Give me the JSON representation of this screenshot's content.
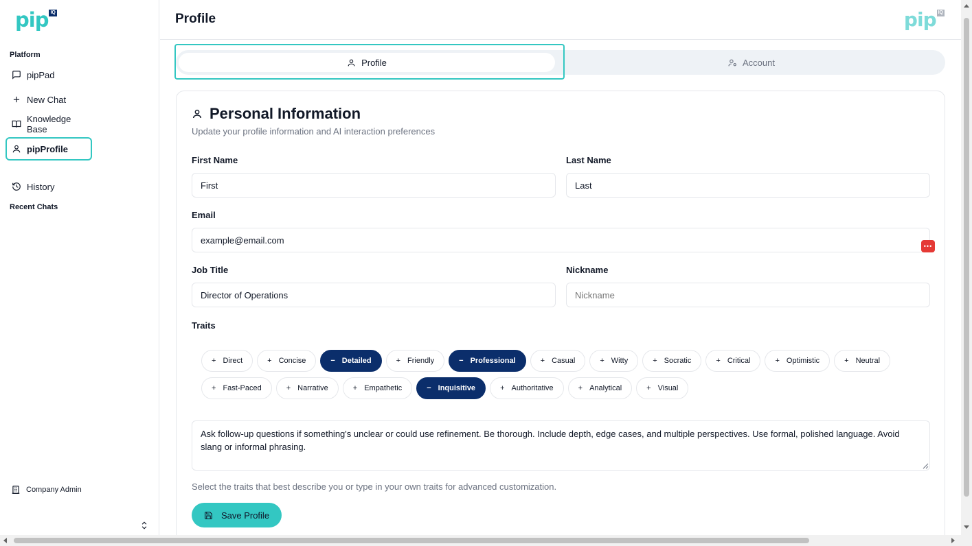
{
  "colors": {
    "brand": "#33c7c2",
    "brand_dark": "#0b2e6b",
    "trait_selected": "#0b2e6b",
    "password_manager": "#e53935"
  },
  "brand": {
    "logo_text": "pip",
    "logo_badge": "IQ"
  },
  "sidebar": {
    "section_platform": "Platform",
    "items": [
      {
        "label": "pipPad",
        "icon": "message-square-icon",
        "active": false
      },
      {
        "label": "New Chat",
        "icon": "plus-icon",
        "active": false
      },
      {
        "label": "Knowledge Base",
        "icon": "book-open-icon",
        "active": false
      },
      {
        "label": "pipProfile",
        "icon": "user-icon",
        "active": true
      },
      {
        "label": "History",
        "icon": "history-icon",
        "active": false
      }
    ],
    "section_recent": "Recent Chats",
    "footer_label": "Company Admin"
  },
  "header": {
    "title": "Profile"
  },
  "tabs": [
    {
      "label": "Profile",
      "icon": "user-icon",
      "active": true
    },
    {
      "label": "Account",
      "icon": "user-cog-icon",
      "active": false
    }
  ],
  "card": {
    "title": "Personal Information",
    "subtitle": "Update your profile information and AI interaction preferences"
  },
  "form": {
    "first_name": {
      "label": "First Name",
      "value": "First"
    },
    "last_name": {
      "label": "Last Name",
      "value": "Last"
    },
    "email": {
      "label": "Email",
      "value": "example@email.com"
    },
    "job_title": {
      "label": "Job Title",
      "value": "Director of Operations"
    },
    "nickname": {
      "label": "Nickname",
      "placeholder": "Nickname"
    },
    "traits_label": "Traits",
    "traits": [
      {
        "label": "Direct",
        "selected": false
      },
      {
        "label": "Concise",
        "selected": false
      },
      {
        "label": "Detailed",
        "selected": true
      },
      {
        "label": "Friendly",
        "selected": false
      },
      {
        "label": "Professional",
        "selected": true
      },
      {
        "label": "Casual",
        "selected": false
      },
      {
        "label": "Witty",
        "selected": false
      },
      {
        "label": "Socratic",
        "selected": false
      },
      {
        "label": "Critical",
        "selected": false
      },
      {
        "label": "Optimistic",
        "selected": false
      },
      {
        "label": "Neutral",
        "selected": false
      },
      {
        "label": "Fast-Paced",
        "selected": false
      },
      {
        "label": "Narrative",
        "selected": false
      },
      {
        "label": "Empathetic",
        "selected": false
      },
      {
        "label": "Inquisitive",
        "selected": true
      },
      {
        "label": "Authoritative",
        "selected": false
      },
      {
        "label": "Analytical",
        "selected": false
      },
      {
        "label": "Visual",
        "selected": false
      }
    ],
    "traits_text": "Ask follow-up questions if something's unclear or could use refinement. Be thorough. Include depth, edge cases, and multiple perspectives. Use formal, polished language. Avoid slang or informal phrasing.",
    "helper": "Select the traits that best describe you or type in your own traits for advanced customization.",
    "save_label": "Save Profile"
  }
}
